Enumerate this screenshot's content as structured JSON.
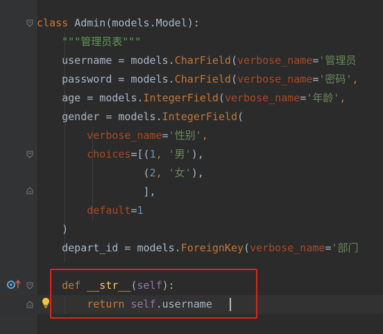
{
  "editor": {
    "lines": [
      {
        "tokens": [
          {
            "t": "class ",
            "c": "kw"
          },
          {
            "t": "Admin",
            "c": "cls"
          },
          {
            "t": "(models.Model):",
            "c": "cls"
          }
        ]
      },
      {
        "tokens": [
          {
            "t": "    ",
            "c": ""
          },
          {
            "t": "\"\"\"管理员表\"\"\"",
            "c": "doc"
          }
        ]
      },
      {
        "tokens": [
          {
            "t": "    username = models.",
            "c": ""
          },
          {
            "t": "CharField",
            "c": "fld"
          },
          {
            "t": "(",
            "c": ""
          },
          {
            "t": "verbose_name",
            "c": "param"
          },
          {
            "t": "=",
            "c": ""
          },
          {
            "t": "'管理员",
            "c": "str"
          }
        ]
      },
      {
        "tokens": [
          {
            "t": "    password = models.",
            "c": ""
          },
          {
            "t": "CharField",
            "c": "fld"
          },
          {
            "t": "(",
            "c": ""
          },
          {
            "t": "verbose_name",
            "c": "param"
          },
          {
            "t": "=",
            "c": ""
          },
          {
            "t": "'密码'",
            "c": "str"
          },
          {
            "t": ",",
            "c": "kw"
          }
        ]
      },
      {
        "tokens": [
          {
            "t": "    age = models.",
            "c": ""
          },
          {
            "t": "IntegerField",
            "c": "fld"
          },
          {
            "t": "(",
            "c": ""
          },
          {
            "t": "verbose_name",
            "c": "param"
          },
          {
            "t": "=",
            "c": ""
          },
          {
            "t": "'年龄'",
            "c": "str"
          },
          {
            "t": ",",
            "c": "kw"
          }
        ]
      },
      {
        "tokens": [
          {
            "t": "    gender = models.",
            "c": ""
          },
          {
            "t": "IntegerField",
            "c": "fld"
          },
          {
            "t": "(",
            "c": ""
          }
        ]
      },
      {
        "tokens": [
          {
            "t": "        ",
            "c": ""
          },
          {
            "t": "verbose_name",
            "c": "param"
          },
          {
            "t": "=",
            "c": ""
          },
          {
            "t": "'性别'",
            "c": "str"
          },
          {
            "t": ",",
            "c": "kw"
          }
        ]
      },
      {
        "tokens": [
          {
            "t": "        ",
            "c": ""
          },
          {
            "t": "choices",
            "c": "param"
          },
          {
            "t": "=[(",
            "c": ""
          },
          {
            "t": "1",
            "c": "num"
          },
          {
            "t": ", ",
            "c": "kw"
          },
          {
            "t": "'男'",
            "c": "str"
          },
          {
            "t": "),",
            "c": ""
          }
        ]
      },
      {
        "tokens": [
          {
            "t": "                 (",
            "c": ""
          },
          {
            "t": "2",
            "c": "num"
          },
          {
            "t": ", ",
            "c": "kw"
          },
          {
            "t": "'女'",
            "c": "str"
          },
          {
            "t": "),",
            "c": ""
          }
        ]
      },
      {
        "tokens": [
          {
            "t": "                 ],",
            "c": ""
          }
        ]
      },
      {
        "tokens": [
          {
            "t": "        ",
            "c": ""
          },
          {
            "t": "default",
            "c": "param"
          },
          {
            "t": "=",
            "c": ""
          },
          {
            "t": "1",
            "c": "num"
          }
        ]
      },
      {
        "tokens": [
          {
            "t": "    )",
            "c": ""
          }
        ]
      },
      {
        "tokens": [
          {
            "t": "    depart_id = models.",
            "c": ""
          },
          {
            "t": "ForeignKey",
            "c": "fld"
          },
          {
            "t": "(",
            "c": ""
          },
          {
            "t": "verbose_name",
            "c": "param"
          },
          {
            "t": "=",
            "c": ""
          },
          {
            "t": "'部门",
            "c": "str"
          }
        ]
      },
      {
        "tokens": []
      },
      {
        "tokens": [
          {
            "t": "    ",
            "c": ""
          },
          {
            "t": "def ",
            "c": "kw"
          },
          {
            "t": "__str__",
            "c": "fn"
          },
          {
            "t": "(",
            "c": ""
          },
          {
            "t": "self",
            "c": "attr"
          },
          {
            "t": "):",
            "c": ""
          }
        ]
      },
      {
        "tokens": [
          {
            "t": "        ",
            "c": ""
          },
          {
            "t": "return ",
            "c": "kw"
          },
          {
            "t": "self",
            "c": "attr"
          },
          {
            "t": ".username",
            "c": ""
          }
        ]
      }
    ]
  },
  "icons": {
    "override": "override-method-icon",
    "bulb": "lightbulb-icon",
    "fold": "fold-marker-icon"
  },
  "colors": {
    "background": "#2b2b2b",
    "gutter": "#313335",
    "highlight_box": "#e8201c"
  }
}
